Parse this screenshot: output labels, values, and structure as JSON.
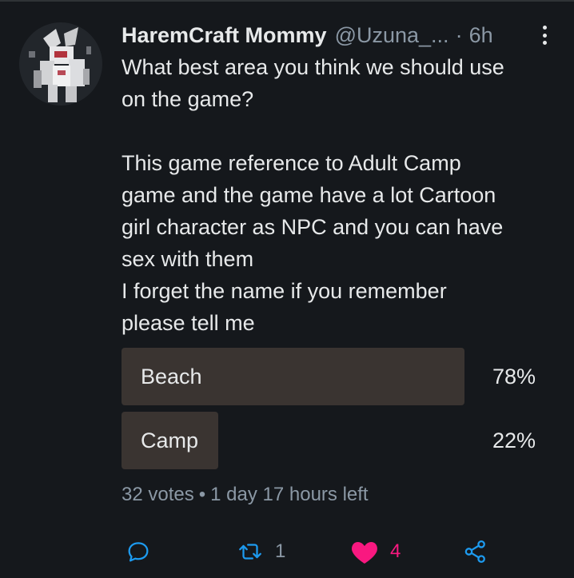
{
  "tweet": {
    "display_name": "HaremCraft Mommy",
    "handle": "@Uzuna_...",
    "separator": "·",
    "time": "6h",
    "text_lines_1": [
      "What best area you think we should use",
      "on the game?"
    ],
    "text_lines_2": [
      "This game reference to Adult Camp",
      "game and the game have a lot Cartoon",
      "girl character as NPC and you can have",
      "sex with them",
      "I forget the name if you remember",
      "please tell me"
    ]
  },
  "poll": {
    "options": [
      {
        "label": "Beach",
        "percent_text": "78%",
        "percent": 78
      },
      {
        "label": "Camp",
        "percent_text": "22%",
        "percent": 22
      }
    ],
    "votes": "32 votes",
    "meta_separator": "•",
    "time_left": "1 day 17 hours left"
  },
  "actions": {
    "reply_icon": "reply-icon",
    "retweet_icon": "retweet-icon",
    "retweet_count": "1",
    "like_icon": "heart-icon",
    "like_count": "4",
    "share_icon": "share-icon"
  },
  "colors": {
    "background": "#15181c",
    "text": "#e7e9ea",
    "secondary_text": "#8b98a5",
    "poll_bar": "#3a3431",
    "like_active": "#f91880"
  }
}
